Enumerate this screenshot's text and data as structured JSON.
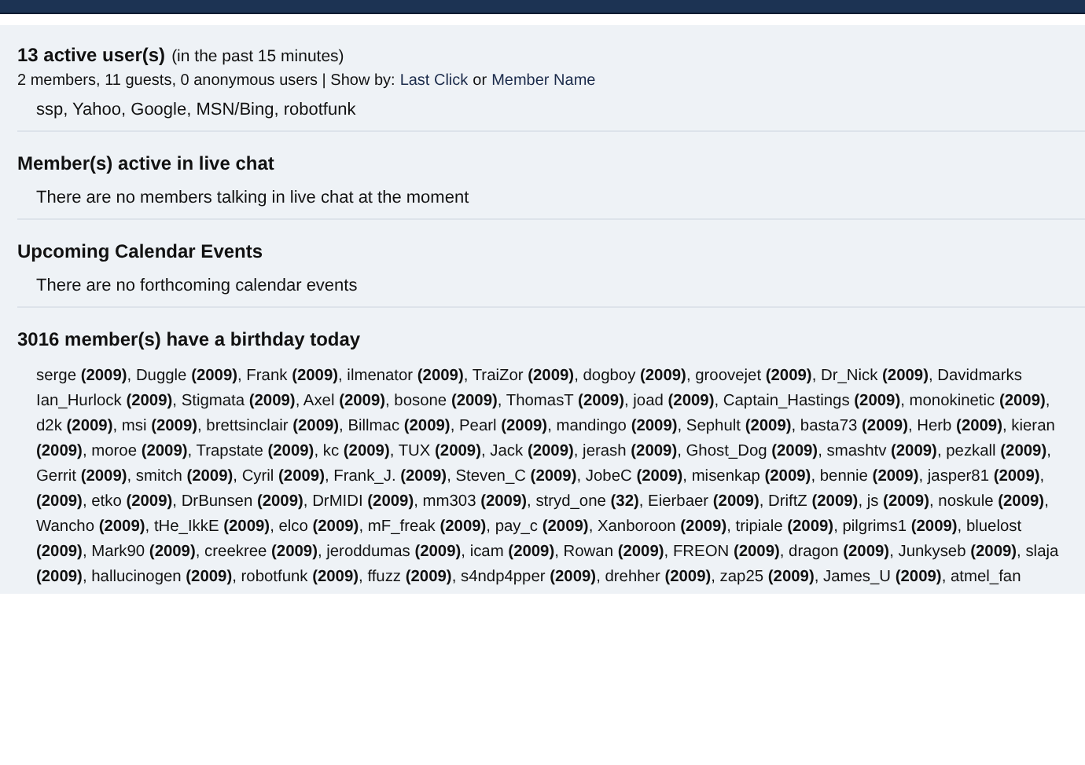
{
  "active_users": {
    "title": "13 active user(s)",
    "note": "(in the past 15 minutes)",
    "summary": "2 members, 11 guests, 0 anonymous users | Show by:",
    "sort_links": [
      "Last Click",
      "Member Name"
    ],
    "joiner": "or",
    "users": "ssp, Yahoo, Google, MSN/Bing, robotfunk"
  },
  "sections": [
    {
      "title": "Member(s) active in live chat",
      "text": "There are no members talking in live chat at the moment"
    },
    {
      "title": "Upcoming Calendar Events",
      "text": "There are no forthcoming calendar events"
    }
  ],
  "birthdays": {
    "title": "3016 member(s) have a birthday today",
    "lines": [
      "serge **(2009)**, Duggle **(2009)**, Frank **(2009)**, ilmenator **(2009)**, TraiZor **(2009)**, dogboy **(2009)**, groovejet **(2009)**, Dr_Nick **(2009)**, Davidmarks",
      "Ian_Hurlock **(2009)**, Stigmata **(2009)**, Axel **(2009)**, bosone **(2009)**, ThomasT **(2009)**, joad **(2009)**, Captain_Hastings **(2009)**, monokinetic **(2009)**,",
      "d2k **(2009)**, msi **(2009)**, brettsinclair **(2009)**, Billmac **(2009)**, Pearl **(2009)**, mandingo **(2009)**, Sephult **(2009)**, basta73 **(2009)**, Herb **(2009)**, kieran",
      "**(2009)**, moroe **(2009)**, Trapstate **(2009)**, kc **(2009)**, TUX **(2009)**, Jack **(2009)**, jerash **(2009)**, Ghost_Dog **(2009)**, smashtv **(2009)**, pezkall **(2009)**,",
      "Gerrit **(2009)**, smitch **(2009)**, Cyril **(2009)**, Frank_J. **(2009)**, Steven_C **(2009)**, JobeC **(2009)**, misenkap **(2009)**, bennie **(2009)**, jasper81 **(2009)**,",
      "**(2009)**, etko **(2009)**, DrBunsen **(2009)**, DrMIDI **(2009)**, mm303 **(2009)**, stryd_one **(32)**, Eierbaer **(2009)**, DriftZ **(2009)**, js **(2009)**, noskule **(2009)**,",
      "Wancho **(2009)**, tHe_IkkE **(2009)**, elco **(2009)**, mF_freak **(2009)**, pay_c **(2009)**, Xanboroon **(2009)**, tripiale **(2009)**, pilgrims1 **(2009)**, bluelost",
      "**(2009)**, Mark90 **(2009)**, creekree **(2009)**, jeroddumas **(2009)**, icam **(2009)**, Rowan **(2009)**, FREON **(2009)**, dragon **(2009)**, Junkyseb **(2009)**, slaja",
      "**(2009)**, hallucinogen **(2009)**, robotfunk **(2009)**, ffuzz **(2009)**, s4ndp4pper **(2009)**, drehher **(2009)**, zap25 **(2009)**, James_U **(2009)**, atmel_fan"
    ]
  }
}
